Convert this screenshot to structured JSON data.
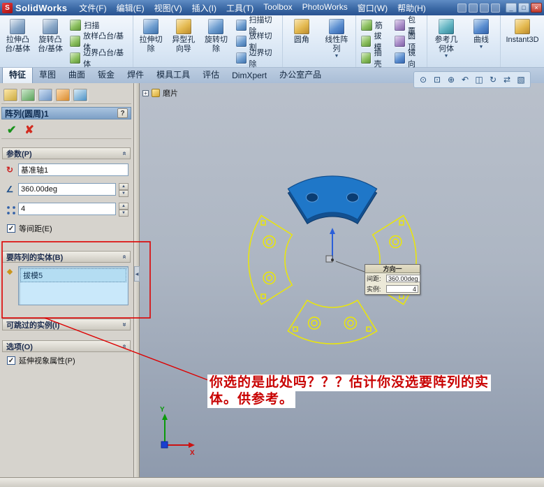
{
  "titlebar": {
    "app": "SolidWorks",
    "menus": [
      "文件(F)",
      "编辑(E)",
      "视图(V)",
      "插入(I)",
      "工具(T)",
      "Toolbox",
      "PhotoWorks",
      "窗口(W)",
      "帮助(H)"
    ],
    "window_buttons": [
      "minimize-icon",
      "maximize-icon",
      "close-icon"
    ],
    "quick_icons": [
      "new-icon",
      "open-icon",
      "save-icon",
      "print-icon"
    ]
  },
  "ribbon": {
    "items": [
      {
        "label": "拉伸凸\n台/基体",
        "icon": "extruded-boss-icon"
      },
      {
        "label": "旋转凸\n台/基体",
        "icon": "revolved-boss-icon"
      },
      {
        "label": "扫描",
        "icon": "swept-boss-icon"
      },
      {
        "label": "放样凸台/基体",
        "icon": "lofted-boss-icon"
      },
      {
        "label": "边界凸台/基体",
        "icon": "boundary-boss-icon"
      },
      {
        "label": "拉伸切\n除",
        "icon": "extruded-cut-icon"
      },
      {
        "label": "异型孔\n向导",
        "icon": "hole-wizard-icon"
      },
      {
        "label": "旋转切\n除",
        "icon": "revolved-cut-icon"
      },
      {
        "label": "扫描切除",
        "icon": "swept-cut-icon"
      },
      {
        "label": "放样切割",
        "icon": "lofted-cut-icon"
      },
      {
        "label": "边界切除",
        "icon": "boundary-cut-icon"
      },
      {
        "label": "圆角",
        "icon": "fillet-icon"
      },
      {
        "label": "线性阵\n列",
        "icon": "linear-pattern-icon"
      },
      {
        "label": "筋",
        "icon": "rib-icon"
      },
      {
        "label": "拔模",
        "icon": "draft-icon"
      },
      {
        "label": "抽壳",
        "icon": "shell-icon"
      },
      {
        "label": "包覆",
        "icon": "wrap-icon"
      },
      {
        "label": "圆顶",
        "icon": "dome-icon"
      },
      {
        "label": "镜向",
        "icon": "mirror-icon"
      },
      {
        "label": "参考几\n何体",
        "icon": "reference-geometry-icon"
      },
      {
        "label": "曲线",
        "icon": "curves-icon"
      },
      {
        "label": "Instant3D",
        "icon": "instant3d-icon"
      }
    ]
  },
  "tabs": {
    "items": [
      "特征",
      "草图",
      "曲面",
      "钣金",
      "焊件",
      "模具工具",
      "评估",
      "DimXpert",
      "办公室产品"
    ],
    "active": "特征"
  },
  "view_toolbar": {
    "icons": [
      "zoom-fit-icon",
      "zoom-area-icon",
      "zoom-inout-icon",
      "previous-view-icon",
      "section-view-icon",
      "rotate-view-icon",
      "pan-icon",
      "display-style-icon"
    ],
    "glyphs": [
      "⊙",
      "⊡",
      "⊕",
      "↶",
      "◫",
      "↻",
      "⇄",
      "▧"
    ]
  },
  "pm": {
    "title": "阵列(圆周)1",
    "manager_tabs": [
      "featuremanager-tree-icon",
      "propertymanager-icon",
      "configurationmanager-icon",
      "dimxpertmanager-icon",
      "displaymanager-icon"
    ],
    "params": {
      "header": "参数(P)",
      "axis": "基准轴1",
      "angle": "360.00deg",
      "count": "4",
      "equal": "等间距(E)"
    },
    "bodies": {
      "header": "要阵列的实体(B)",
      "item": "拔模5"
    },
    "skip": {
      "header": "可跳过的实例(I)"
    },
    "options": {
      "header": "选项(O)",
      "propagate": "延伸视象属性(P)"
    }
  },
  "viewport": {
    "part_name": "磨片",
    "callout": {
      "title": "方向一",
      "rows": [
        {
          "label": "间距:",
          "value": "360.00deg"
        },
        {
          "label": "实例:",
          "value": "4"
        }
      ]
    },
    "annotation": [
      "你选的是此处吗？？？估计你没选要阵列的实",
      "体。供参考。"
    ],
    "triad": {
      "x": "X",
      "y": "Y"
    }
  },
  "icons": {
    "check_ok": "✔",
    "cancel_x": "✘",
    "help": "?",
    "spin_up": "▲",
    "spin_down": "▼",
    "checkbox_check": "✓",
    "chevron": "«",
    "collapse_left": "◀",
    "expander_plus": "+",
    "dropdown": "▼",
    "win_min": "_",
    "win_max": "□",
    "win_close": "×",
    "pm_axis": "↻",
    "pm_angle": "∠",
    "pm_bodies": "◆",
    "logo_letter": "S"
  },
  "colors": {
    "solid_blue": "#1f77c8",
    "preview_yellow": "#eeea12",
    "annotation_red": "#c80000",
    "selection_blue": "#c9e8fa",
    "titlebar_blue": "#3b69a5"
  }
}
